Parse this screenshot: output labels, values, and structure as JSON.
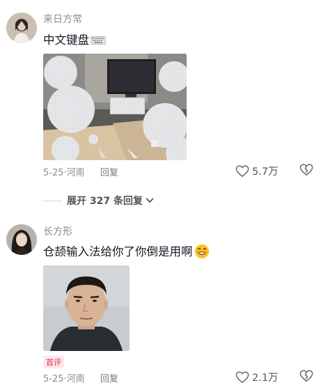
{
  "comments": [
    {
      "username": "来日方常",
      "text": "中文键盘",
      "date": "5-25",
      "location": "河南",
      "reply_label": "回复",
      "likes": "5.7万",
      "image_icon": "keyboard-photo",
      "emoji_icon": "keyboard-icon"
    },
    {
      "username": "长方形",
      "text": "仓颉输入法给你了你倒是用啊",
      "date": "5-25",
      "location": "河南",
      "reply_label": "回复",
      "likes": "2.1万",
      "badge": "首评",
      "image_icon": "man-portrait-photo",
      "emoji_icon": "grinning-face-emoji"
    }
  ],
  "expand_replies": "展开 327 条回复",
  "colors": {
    "primary_text": "#161823",
    "secondary_text": "#8a8b91",
    "badge_bg": "#fde8ea",
    "badge_text": "#e3304b"
  }
}
